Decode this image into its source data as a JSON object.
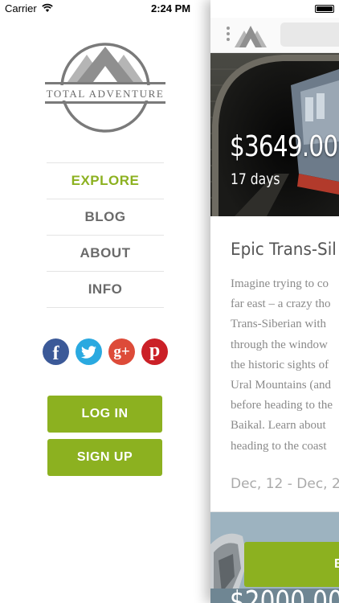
{
  "status_bar": {
    "carrier": "Carrier",
    "time": "2:24 PM"
  },
  "logo": {
    "text": "TOTAL ADVENTURE"
  },
  "menu": {
    "items": [
      {
        "label": "EXPLORE",
        "active": true
      },
      {
        "label": "BLOG",
        "active": false
      },
      {
        "label": "ABOUT",
        "active": false
      },
      {
        "label": "INFO",
        "active": false
      }
    ]
  },
  "social": {
    "facebook": "f",
    "twitter": "t",
    "googleplus": "g+",
    "pinterest": "p"
  },
  "auth": {
    "login_label": "LOG IN",
    "signup_label": "SIGN UP"
  },
  "trip": {
    "price": "$3649.00",
    "duration": "17 days",
    "title": "Epic Trans-Sil",
    "description_lines": [
      "Imagine trying to co",
      "far east – a crazy tho",
      "Trans-Siberian with",
      "through the window",
      "the historic sights of",
      "Ural Mountains (and",
      "before heading to the",
      "Baikal. Learn about",
      "heading to the coast"
    ],
    "dates": "Dec, 12 - Dec, 2"
  },
  "next_trip": {
    "book_label": "B",
    "price": "$2000.00"
  },
  "colors": {
    "accent": "#8cb120",
    "menu_text": "#6a6a6a",
    "facebook": "#3b5998",
    "twitter": "#2aa9e0",
    "googleplus": "#dd4b39",
    "pinterest": "#cb2027"
  }
}
